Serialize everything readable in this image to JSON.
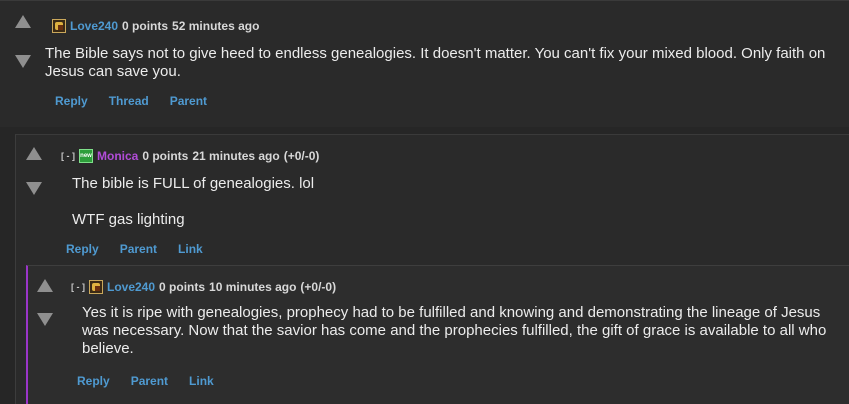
{
  "comments": [
    {
      "toggle": "",
      "username": "Love240",
      "points": "0 points",
      "time": "52 minutes ago",
      "votes": "",
      "body": [
        "The Bible says not to give heed to endless genealogies. It doesn't matter. You can't fix your mixed blood. Only faith on Jesus can save you."
      ],
      "links": [
        "Reply",
        "Thread",
        "Parent"
      ]
    },
    {
      "toggle": "[ - ]",
      "username": "Monica",
      "points": "0 points",
      "time": "21 minutes ago",
      "votes": "(+0/-0)",
      "body": [
        "The bible is FULL of genealogies. lol",
        "WTF gas lighting"
      ],
      "links": [
        "Reply",
        "Parent",
        "Link"
      ]
    },
    {
      "toggle": "[ - ]",
      "username": "Love240",
      "points": "0 points",
      "time": "10 minutes ago",
      "votes": "(+0/-0)",
      "body": [
        "Yes it is ripe with genealogies, prophecy had to be fulfilled and knowing and demonstrating the lineage of Jesus was necessary. Now that the savior has come and the prophecies fulfilled, the gift of grace is available to all who believe."
      ],
      "links": [
        "Reply",
        "Parent",
        "Link"
      ]
    }
  ],
  "icons": {
    "upvote": "upvote-arrow-icon",
    "downvote": "downvote-arrow-icon",
    "avatar_love240": "love240-avatar-icon",
    "avatar_monica": "monica-avatar-icon"
  },
  "colors": {
    "username_love240": "#4f9ad1",
    "username_monica": "#b14cd8",
    "links": "#4f9ad1",
    "thread_line": "#9a35c9",
    "background": "#262626"
  },
  "avatar_monica_text": "new"
}
